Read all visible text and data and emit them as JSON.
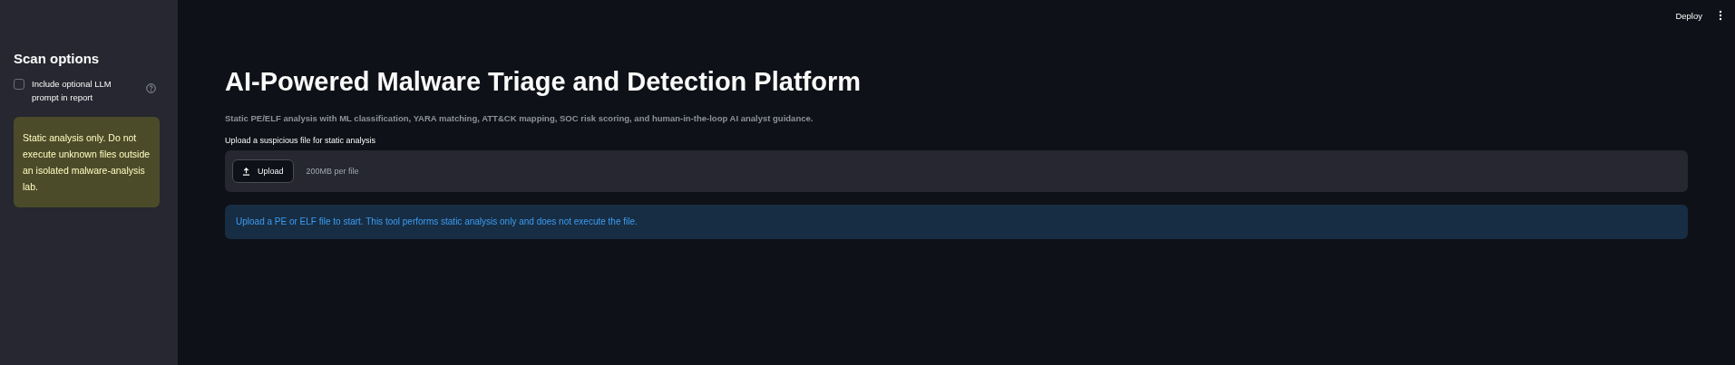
{
  "header": {
    "deploy_label": "Deploy"
  },
  "sidebar": {
    "title": "Scan options",
    "checkbox": {
      "label": "Include optional LLM prompt in report",
      "checked": false
    },
    "warning": "Static analysis only. Do not execute unknown files outside an isolated malware-analysis lab."
  },
  "main": {
    "title": "AI-Powered Malware Triage and Detection Platform",
    "subtitle": "Static PE/ELF analysis with ML classification, YARA matching, ATT&CK mapping, SOC risk scoring, and human-in-the-loop AI analyst guidance.",
    "uploader": {
      "label": "Upload a suspicious file for static analysis",
      "button": "Upload",
      "limit": "200MB per file"
    },
    "info": "Upload a PE or ELF file to start. This tool performs static analysis only and does not execute the file."
  }
}
